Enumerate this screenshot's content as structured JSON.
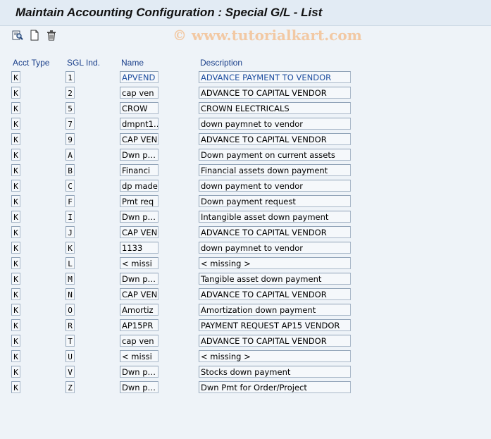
{
  "window": {
    "title": "Maintain Accounting Configuration : Special G/L - List",
    "watermark": "© www.tutorialkart.com"
  },
  "toolbar": {
    "buttons": [
      {
        "name": "find-icon"
      },
      {
        "name": "new-document-icon"
      },
      {
        "name": "delete-icon"
      }
    ]
  },
  "table": {
    "headers": {
      "acct_type": "Acct Type",
      "sgl_ind": "SGL Ind.",
      "name": "Name",
      "description": "Description"
    },
    "rows": [
      {
        "acct_type": "K",
        "sgl_ind": "1",
        "name": "APVEND",
        "description": "ADVANCE PAYMENT TO VENDOR"
      },
      {
        "acct_type": "K",
        "sgl_ind": "2",
        "name": "cap ven",
        "description": "ADVANCE TO CAPITAL VENDOR"
      },
      {
        "acct_type": "K",
        "sgl_ind": "5",
        "name": "CROW",
        "description": "CROWN ELECTRICALS"
      },
      {
        "acct_type": "K",
        "sgl_ind": "7",
        "name": "dmpnt1…",
        "description": "down paymnet to vendor"
      },
      {
        "acct_type": "K",
        "sgl_ind": "9",
        "name": "CAP VEN",
        "description": "ADVANCE TO CAPITAL VENDOR"
      },
      {
        "acct_type": "K",
        "sgl_ind": "A",
        "name": "Dwn p…",
        "description": "Down payment on current assets"
      },
      {
        "acct_type": "K",
        "sgl_ind": "B",
        "name": "Financi",
        "description": "Financial assets down payment"
      },
      {
        "acct_type": "K",
        "sgl_ind": "C",
        "name": "dp made",
        "description": "down payment to vendor"
      },
      {
        "acct_type": "K",
        "sgl_ind": "F",
        "name": "Pmt req",
        "description": "Down payment request"
      },
      {
        "acct_type": "K",
        "sgl_ind": "I",
        "name": "Dwn p…",
        "description": "Intangible asset down payment"
      },
      {
        "acct_type": "K",
        "sgl_ind": "J",
        "name": "CAP VEN",
        "description": "ADVANCE TO CAPITAL VENDOR"
      },
      {
        "acct_type": "K",
        "sgl_ind": "K",
        "name": "1133",
        "description": "down paymnet to vendor"
      },
      {
        "acct_type": "K",
        "sgl_ind": "L",
        "name": "< missi",
        "description": "< missing >"
      },
      {
        "acct_type": "K",
        "sgl_ind": "M",
        "name": "Dwn p…",
        "description": "Tangible asset down payment"
      },
      {
        "acct_type": "K",
        "sgl_ind": "N",
        "name": "CAP VEN",
        "description": "ADVANCE TO CAPITAL VENDOR"
      },
      {
        "acct_type": "K",
        "sgl_ind": "O",
        "name": "Amortiz",
        "description": "Amortization down payment"
      },
      {
        "acct_type": "K",
        "sgl_ind": "R",
        "name": "AP15PR",
        "description": "PAYMENT REQUEST AP15 VENDOR"
      },
      {
        "acct_type": "K",
        "sgl_ind": "T",
        "name": "cap ven",
        "description": "ADVANCE TO CAPITAL VENDOR"
      },
      {
        "acct_type": "K",
        "sgl_ind": "U",
        "name": "< missi",
        "description": "< missing >"
      },
      {
        "acct_type": "K",
        "sgl_ind": "V",
        "name": "Dwn p…",
        "description": "Stocks down payment"
      },
      {
        "acct_type": "K",
        "sgl_ind": "Z",
        "name": "Dwn p…",
        "description": "Dwn Pmt for Order/Project"
      }
    ]
  }
}
